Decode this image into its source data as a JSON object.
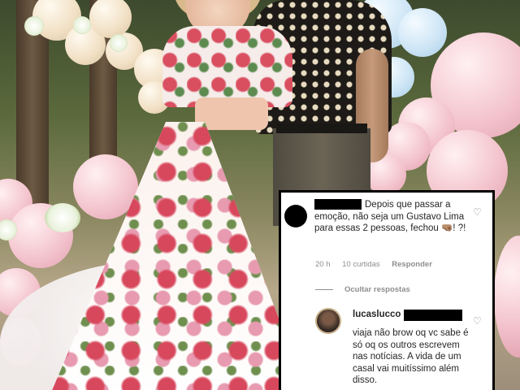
{
  "comment_1": {
    "text": "Depois que passar a emoção, não seja um Gustavo Lima para essas 2 pessoas, fechou 🤜🏽! ?!",
    "time": "20 h",
    "likes": "10 curtidas",
    "reply_label": "Responder"
  },
  "hide_replies_label": "Ocultar respostas",
  "comment_2": {
    "username": "lucaslucco",
    "text": "viaja não brow oq vc sabe é só oq os outros escrevem nas notícias. A vida de um casal vai muitíssimo além disso."
  },
  "colors": {
    "panel_bg": "#ffffff",
    "border": "#000000",
    "text": "#262626",
    "muted": "#8e8e8e"
  },
  "icons": [
    "heart-icon",
    "avatar"
  ]
}
